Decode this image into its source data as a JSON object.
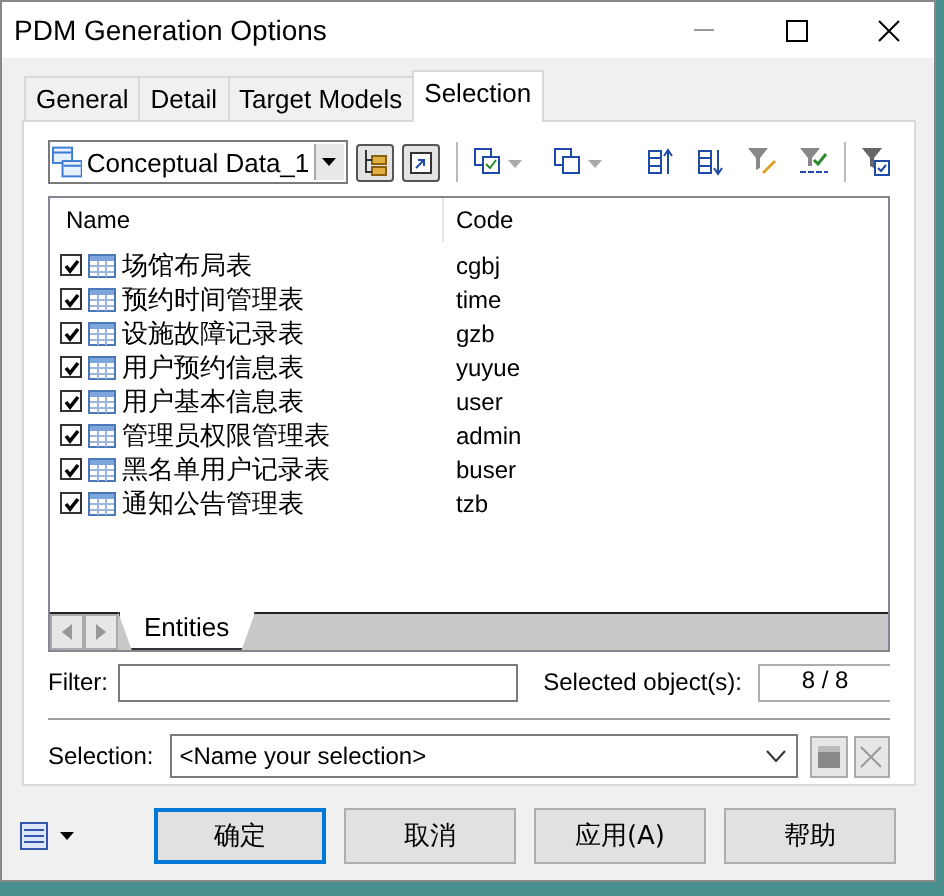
{
  "window": {
    "title": "PDM Generation Options"
  },
  "tabs": [
    {
      "label": "General",
      "selected": false
    },
    {
      "label": "Detail",
      "selected": false
    },
    {
      "label": "Target Models",
      "selected": false
    },
    {
      "label": "Selection",
      "selected": true
    }
  ],
  "model_dropdown": {
    "value": "Conceptual Data_1"
  },
  "list": {
    "columns": [
      "Name",
      "Code"
    ],
    "rows": [
      {
        "name": "场馆布局表",
        "code": "cgbj",
        "checked": true
      },
      {
        "name": "预约时间管理表",
        "code": "time",
        "checked": true
      },
      {
        "name": "设施故障记录表",
        "code": "gzb",
        "checked": true
      },
      {
        "name": "用户预约信息表",
        "code": "yuyue",
        "checked": true
      },
      {
        "name": "用户基本信息表",
        "code": "user",
        "checked": true
      },
      {
        "name": "管理员权限管理表",
        "code": "admin",
        "checked": true
      },
      {
        "name": "黑名单用户记录表",
        "code": "buser",
        "checked": true
      },
      {
        "name": "通知公告管理表",
        "code": "tzb",
        "checked": true
      }
    ]
  },
  "sheet_tabs": [
    {
      "label": "Entities",
      "selected": true
    }
  ],
  "filter": {
    "label": "Filter:"
  },
  "selected_count": {
    "label": "Selected object(s):",
    "value": "8 / 8"
  },
  "selection": {
    "label": "Selection:",
    "placeholder": "<Name your selection>"
  },
  "buttons": [
    {
      "label": "确定",
      "default": true
    },
    {
      "label": "取消",
      "default": false
    },
    {
      "label": "应用(A)",
      "default": false
    },
    {
      "label": "帮助",
      "default": false
    }
  ]
}
